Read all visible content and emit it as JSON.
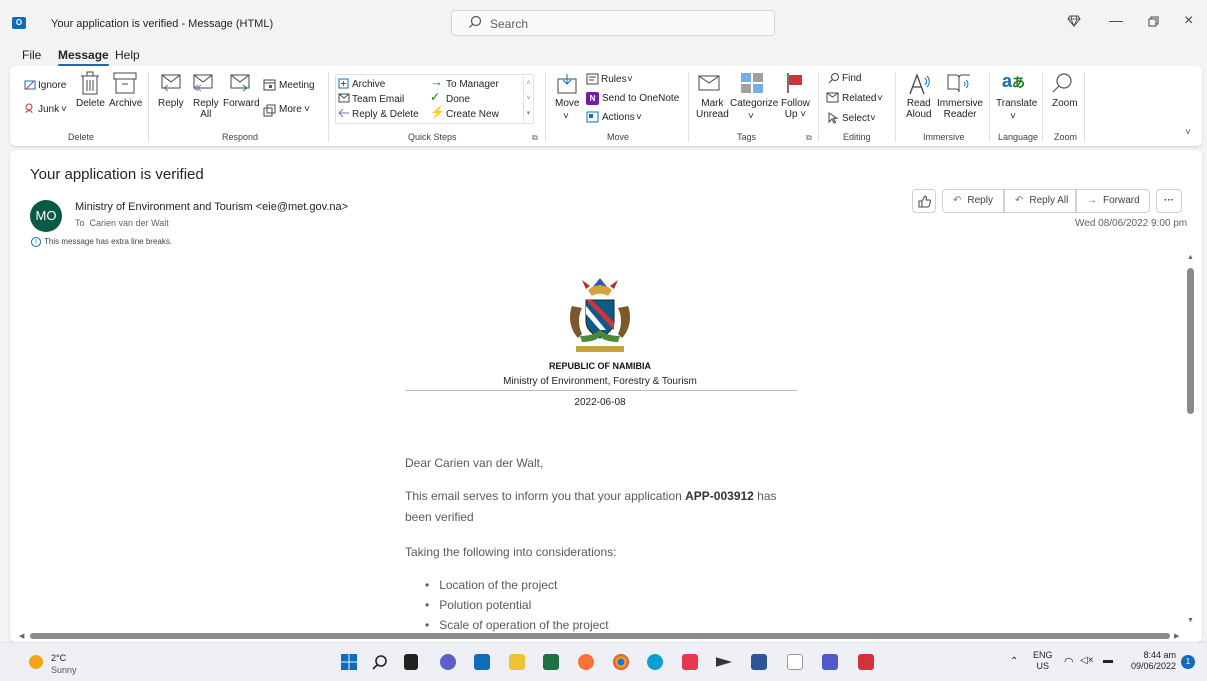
{
  "window": {
    "title": "Your application is verified  -  Message (HTML)",
    "search_placeholder": "Search"
  },
  "menu": [
    "File",
    "Message",
    "Help"
  ],
  "ribbon": {
    "delete_group": {
      "ignore": "Ignore",
      "junk": "Junk",
      "delete": "Delete",
      "archive": "Archive",
      "label": "Delete"
    },
    "respond_group": {
      "reply": "Reply",
      "reply_all_1": "Reply",
      "reply_all_2": "All",
      "forward": "Forward",
      "meeting": "Meeting",
      "more": "More",
      "label": "Respond"
    },
    "quick_steps": {
      "items": [
        "Archive",
        "Team Email",
        "Reply & Delete",
        "To Manager",
        "Done",
        "Create New"
      ],
      "label": "Quick Steps"
    },
    "move_group": {
      "move": "Move",
      "rules": "Rules",
      "onenote": "Send to OneNote",
      "actions": "Actions",
      "label": "Move"
    },
    "tags_group": {
      "mark_1": "Mark",
      "mark_2": "Unread",
      "categorize": "Categorize",
      "follow_1": "Follow",
      "follow_2": "Up",
      "label": "Tags"
    },
    "editing_group": {
      "find": "Find",
      "related": "Related",
      "select": "Select",
      "label": "Editing"
    },
    "immersive_group": {
      "read_1": "Read",
      "read_2": "Aloud",
      "imm_1": "Immersive",
      "imm_2": "Reader",
      "label": "Immersive"
    },
    "language_group": {
      "translate": "Translate",
      "label": "Language"
    },
    "zoom_group": {
      "zoom": "Zoom",
      "label": "Zoom"
    }
  },
  "message": {
    "subject": "Your application is verified",
    "avatar_initials": "MO",
    "from": "Ministry of Environment and Tourism <eie@met.gov.na>",
    "to_label": "To",
    "to": "Carien van der Walt",
    "info_note": "This message has extra line breaks.",
    "actions": {
      "reply": "Reply",
      "reply_all": "Reply All",
      "forward": "Forward"
    },
    "date": "Wed 08/06/2022 9:00 pm"
  },
  "letterhead": {
    "republic": "REPUBLIC OF NAMIBIA",
    "ministry": "Ministry of Environment, Forestry & Tourism",
    "date": "2022-06-08"
  },
  "body": {
    "greeting": "Dear Carien van der Walt,",
    "line1_pre": "This email serves to inform you that your application ",
    "app_id": "APP-003912",
    "line1_post": " has",
    "line2": "been verified",
    "considerations": "Taking the following into considerations:",
    "bullets": [
      "Location of the project",
      "Polution potential",
      "Scale of operation of the project"
    ]
  },
  "taskbar": {
    "weather_temp": "2°C",
    "weather_desc": "Sunny",
    "lang_1": "ENG",
    "lang_2": "US",
    "time": "8:44 am",
    "date": "09/06/2022",
    "notif_count": "1"
  },
  "colors": {
    "accent": "#0f6cbd",
    "avatar": "#0b5a47",
    "flag": "#d13438"
  }
}
